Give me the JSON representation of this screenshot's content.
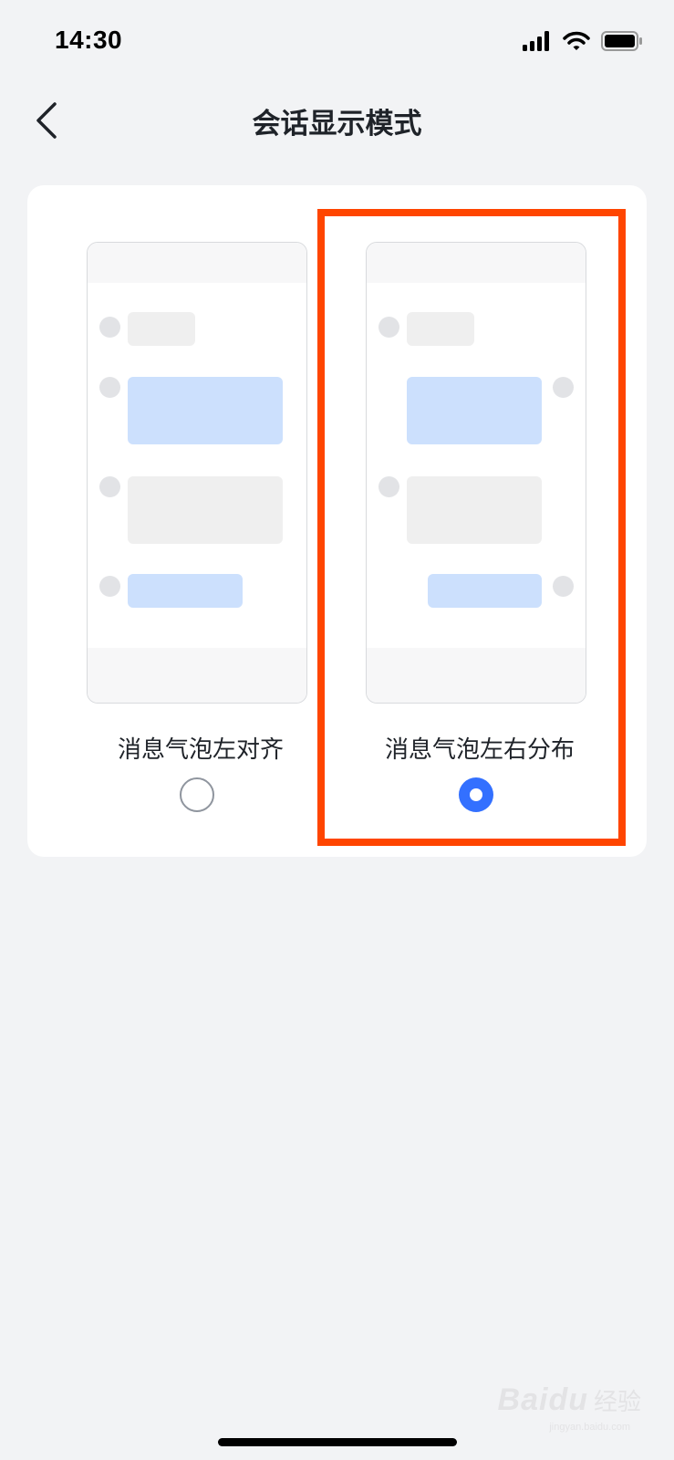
{
  "status_bar": {
    "time": "14:30",
    "icons": [
      "signal-icon",
      "wifi-icon",
      "battery-icon"
    ]
  },
  "nav": {
    "back_icon": "chevron-left-icon",
    "title": "会话显示模式"
  },
  "options": [
    {
      "label": "消息气泡左对齐",
      "selected": false
    },
    {
      "label": "消息气泡左右分布",
      "selected": true
    }
  ],
  "colors": {
    "accent": "#3370ff",
    "highlight": "#ff4500",
    "bubble_blue": "#cce0fd",
    "bubble_gray": "#efefef",
    "background": "#f2f3f5"
  },
  "watermark": {
    "logo": "Baidu",
    "text": "经验",
    "url": "jingyan.baidu.com"
  }
}
